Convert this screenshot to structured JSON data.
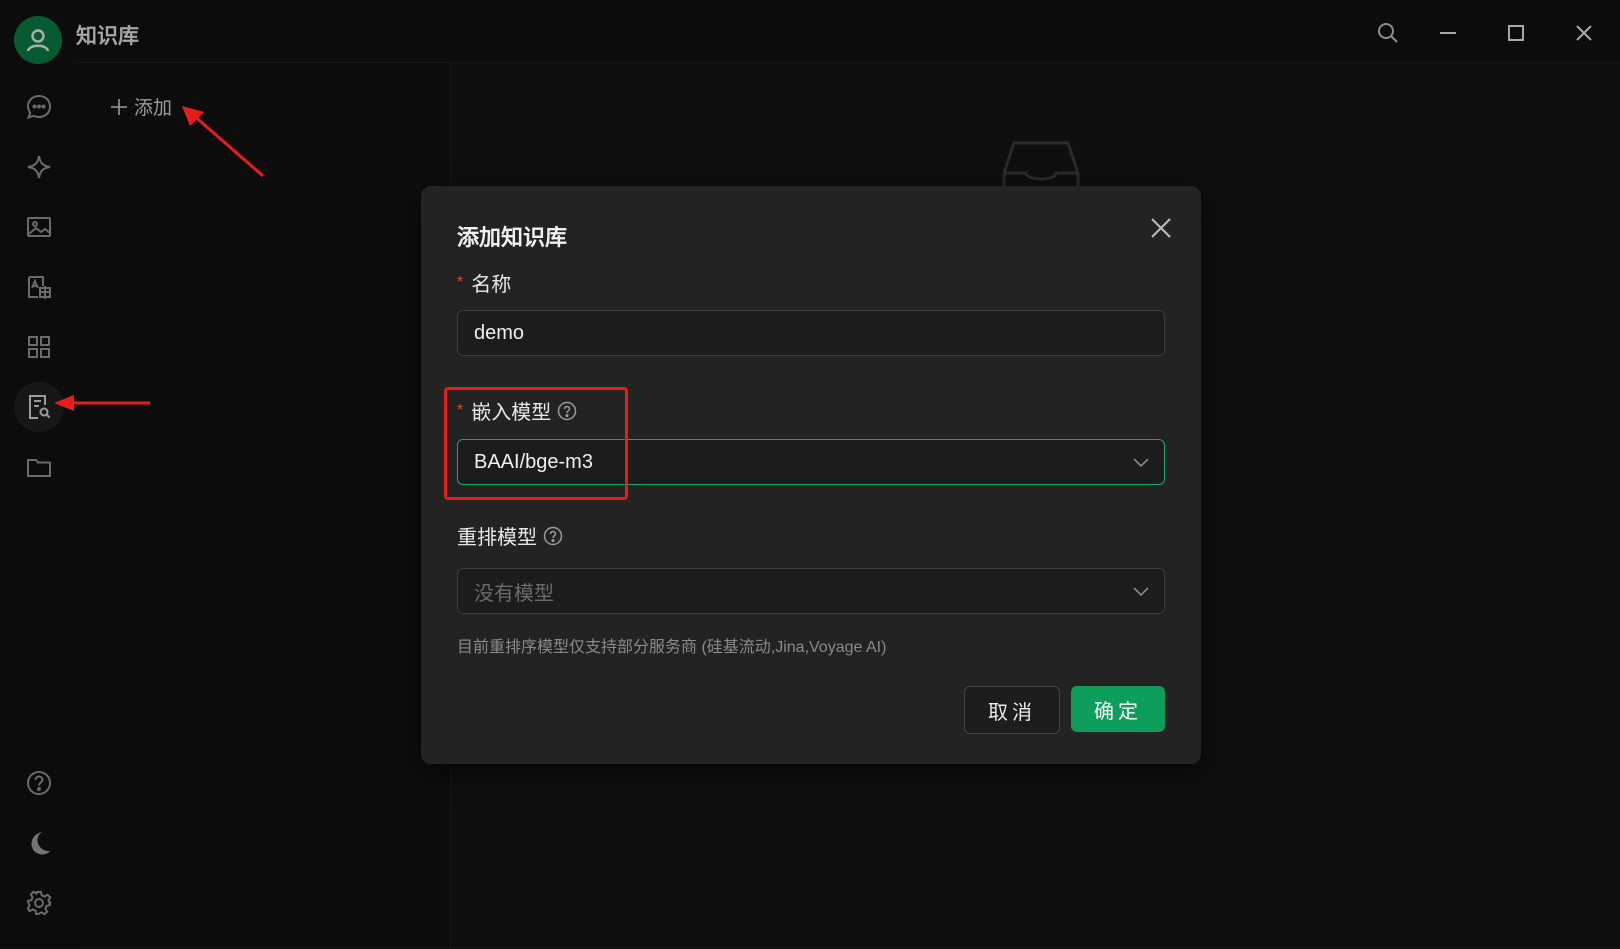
{
  "window": {
    "title": "知识库"
  },
  "list_panel": {
    "add_label": "添加"
  },
  "modal": {
    "title": "添加知识库",
    "required_mark": "*",
    "name_label": "名称",
    "name_value": "demo",
    "embed_label": "嵌入模型",
    "embed_value": "BAAI/bge-m3",
    "rerank_label": "重排模型",
    "rerank_placeholder": "没有模型",
    "hint": "目前重排序模型仅支持部分服务商 (硅基流动,Jina,Voyage AI)",
    "cancel_label": "取消",
    "ok_label": "确定"
  },
  "colors": {
    "accent": "#0e9e5c",
    "focus_border": "#16a866",
    "required": "#e04a3f",
    "annotation": "#e81c1c"
  },
  "icons": {
    "sidebar": [
      "chat-icon",
      "sparkle-icon",
      "image-icon",
      "translate-icon",
      "apps-icon",
      "knowledge-icon",
      "folder-icon",
      "help-icon",
      "moon-icon",
      "gear-icon"
    ]
  }
}
